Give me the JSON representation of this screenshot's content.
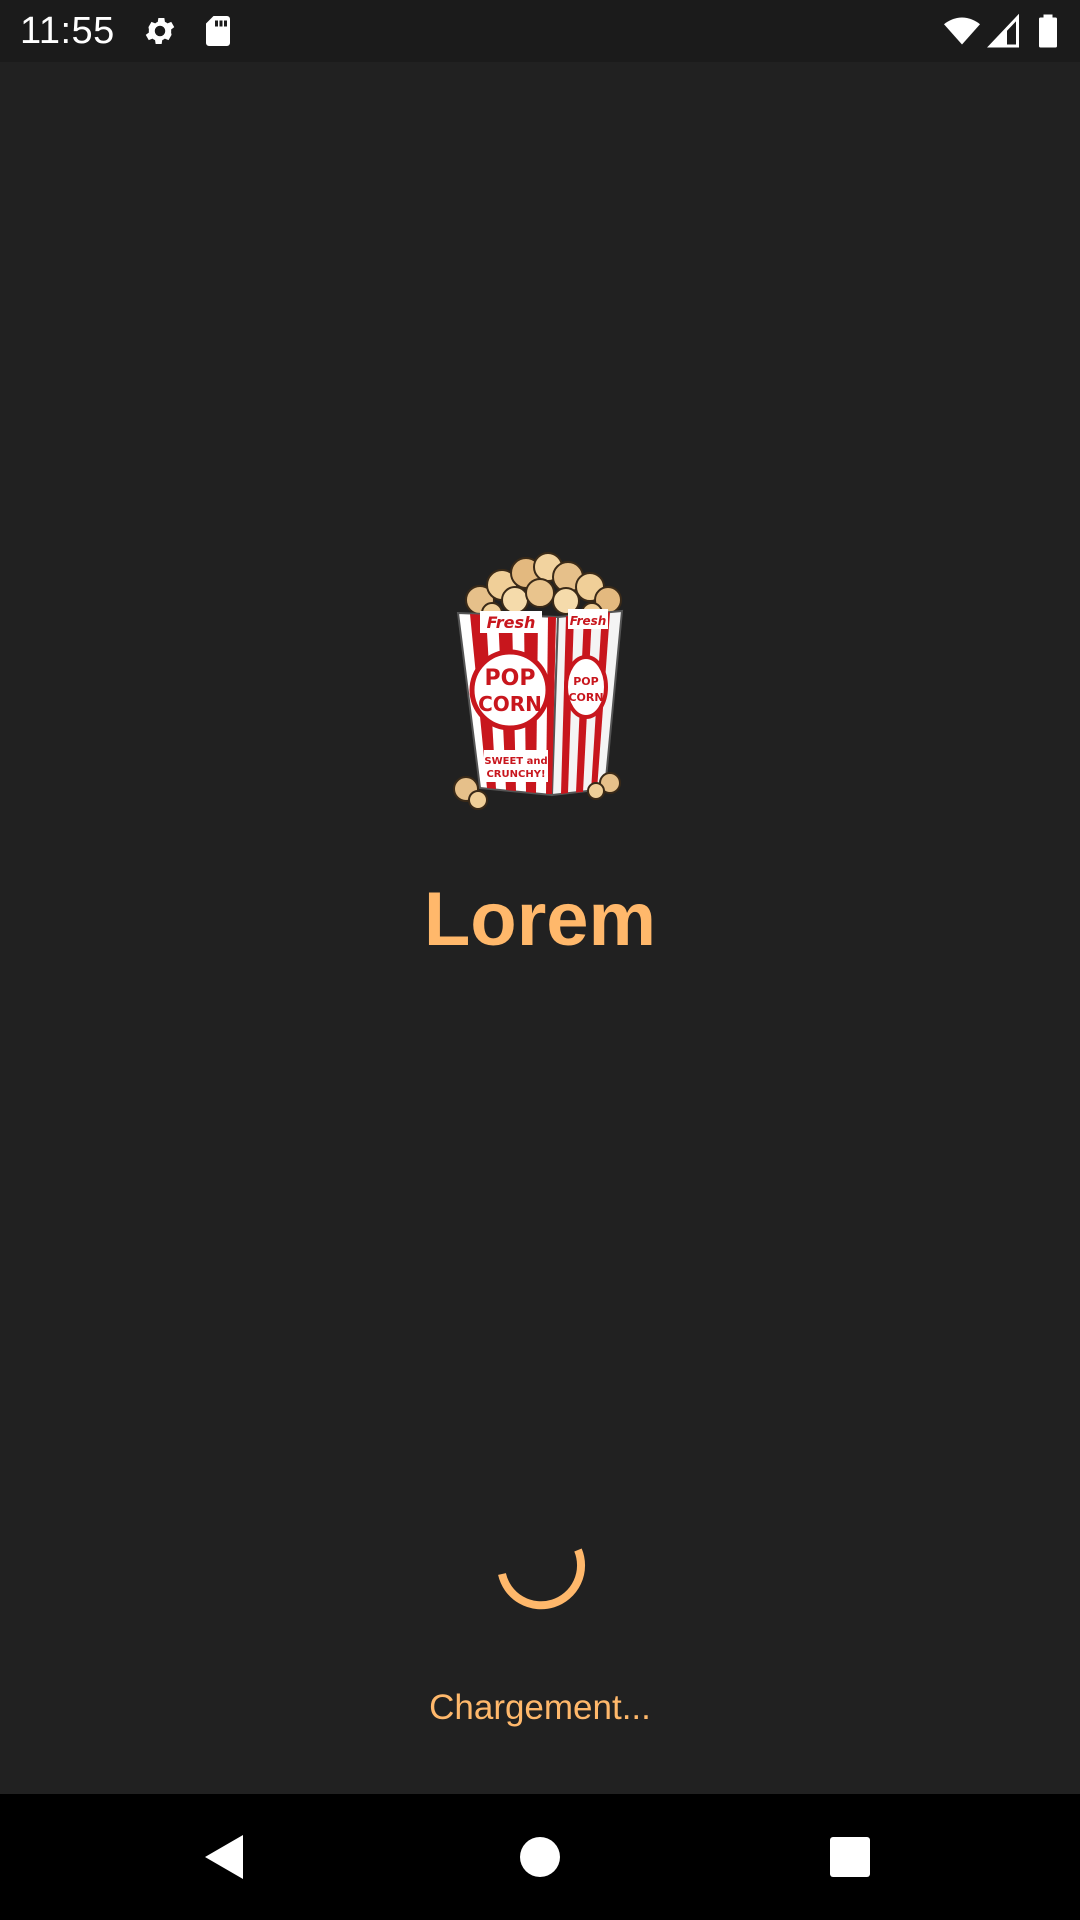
{
  "status_bar": {
    "time": "11:55",
    "icons": [
      "gear-icon",
      "sd-card-icon",
      "wifi-icon",
      "cell-signal-icon",
      "battery-icon"
    ]
  },
  "splash": {
    "logo_text": {
      "fresh": "Fresh",
      "pop": "POP",
      "corn": "CORN",
      "sweet": "SWEET and",
      "crunchy": "CRUNCHY!"
    },
    "title": "Lorem",
    "loading_text": "Chargement..."
  },
  "nav_bar": {
    "buttons": [
      "back-icon",
      "home-icon",
      "recents-icon"
    ]
  },
  "colors": {
    "background": "#212121",
    "status_bar": "#1b1b1b",
    "nav_bar": "#000000",
    "accent": "#ffb86b",
    "popcorn_red": "#c8161d"
  }
}
